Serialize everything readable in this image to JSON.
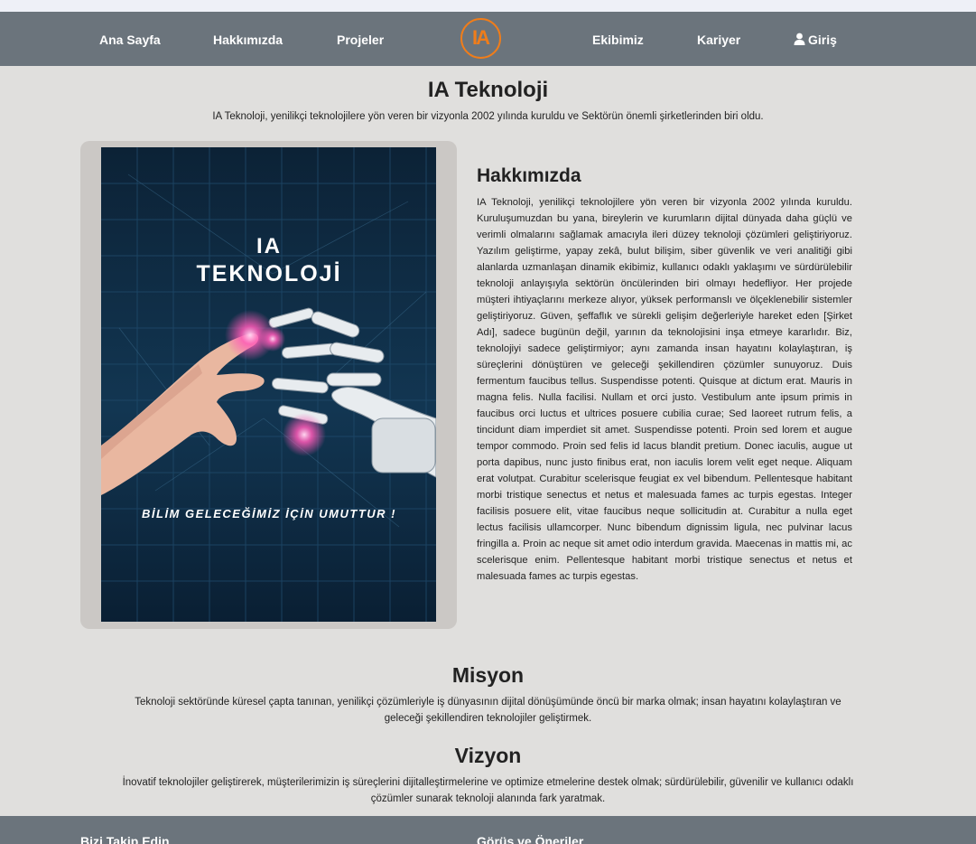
{
  "nav": {
    "items_left": [
      "Ana Sayfa",
      "Hakkımızda",
      "Projeler"
    ],
    "logo_text": "IA",
    "items_right": [
      "Ekibimiz",
      "Kariyer"
    ],
    "login_label": "Giriş",
    "login_icon": "user-icon"
  },
  "header": {
    "title": "IA Teknoloji",
    "subtitle": "IA Teknoloji, yenilikçi teknolojilere yön veren bir vizyonla 2002 yılında kuruldu ve Sektörün önemli şirketlerinden biri oldu."
  },
  "poster": {
    "title_line1": "IA",
    "title_line2": "TEKNOLOJİ",
    "tagline": "BİLİM GELECEĞİMİZ İÇİN UMUTTUR !"
  },
  "about": {
    "title": "Hakkımızda",
    "body": "IA Teknoloji, yenilikçi teknolojilere yön veren bir vizyonla 2002 yılında kuruldu. Kuruluşumuzdan bu yana, bireylerin ve kurumların dijital dünyada daha güçlü ve verimli olmalarını sağlamak amacıyla ileri düzey teknoloji çözümleri geliştiriyoruz. Yazılım geliştirme, yapay zekâ, bulut bilişim, siber güvenlik ve veri analitiği gibi alanlarda uzmanlaşan dinamik ekibimiz, kullanıcı odaklı yaklaşımı ve sürdürülebilir teknoloji anlayışıyla sektörün öncülerinden biri olmayı hedefliyor. Her projede müşteri ihtiyaçlarını merkeze alıyor, yüksek performanslı ve ölçeklenebilir sistemler geliştiriyoruz. Güven, şeffaflık ve sürekli gelişim değerleriyle hareket eden [Şirket Adı], sadece bugünün değil, yarının da teknolojisini inşa etmeye kararlıdır. Biz, teknolojiyi sadece geliştirmiyor; aynı zamanda insan hayatını kolaylaştıran, iş süreçlerini dönüştüren ve geleceği şekillendiren çözümler sunuyoruz. Duis fermentum faucibus tellus. Suspendisse potenti. Quisque at dictum erat. Mauris in magna felis. Nulla facilisi. Nullam et orci justo. Vestibulum ante ipsum primis in faucibus orci luctus et ultrices posuere cubilia curae; Sed laoreet rutrum felis, a tincidunt diam imperdiet sit amet. Suspendisse potenti. Proin sed lorem et augue tempor commodo. Proin sed felis id lacus blandit pretium. Donec iaculis, augue ut porta dapibus, nunc justo finibus erat, non iaculis lorem velit eget neque. Aliquam erat volutpat. Curabitur scelerisque feugiat ex vel bibendum. Pellentesque habitant morbi tristique senectus et netus et malesuada fames ac turpis egestas. Integer facilisis posuere elit, vitae faucibus neque sollicitudin at. Curabitur a nulla eget lectus facilisis ullamcorper. Nunc bibendum dignissim ligula, nec pulvinar lacus fringilla a. Proin ac neque sit amet odio interdum gravida. Maecenas in mattis mi, ac scelerisque enim. Pellentesque habitant morbi tristique senectus et netus et malesuada fames ac turpis egestas."
  },
  "mission": {
    "title": "Misyon",
    "line1": "Teknoloji sektöründe küresel çapta tanınan, yenilikçi çözümleriyle iş dünyasının dijital dönüşümünde öncü bir marka olmak; insan hayatını kolaylaştıran ve",
    "line2": "geleceği şekillendiren teknolojiler geliştirmek."
  },
  "vision": {
    "title": "Vizyon",
    "line1": "İnovatif teknolojiler geliştirerek, müşterilerimizin iş süreçlerini dijitalleştirmelerine ve optimize etmelerine destek olmak; sürdürülebilir, güvenilir ve kullanıcı odaklı",
    "line2": "çözümler sunarak teknoloji alanında fark yaratmak."
  },
  "footer": {
    "follow_title": "Bizi Takip Edin",
    "feedback_title": "Görüş ve Öneriler"
  },
  "colors": {
    "navbar": "#6b747c",
    "background": "#e0dfdd",
    "logo_accent": "#f07d1a",
    "poster_bg": "#0d2438",
    "poster_glow": "#ff4fb0"
  }
}
